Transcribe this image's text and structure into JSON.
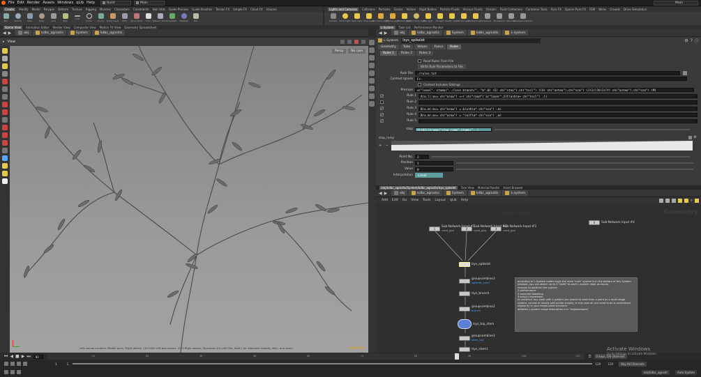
{
  "menubar": {
    "items": [
      "File",
      "Edit",
      "Render",
      "Assets",
      "Windows",
      "qLib",
      "Help"
    ],
    "build": "Build",
    "main": "Main",
    "right_main": "Main"
  },
  "shelf_tabs_left": [
    "Create",
    "Modify",
    "Model",
    "Polygon",
    "Deform",
    "Texture",
    "Rigging",
    "Muscles",
    "Characters",
    "Constraints",
    "Hair Utils",
    "Guide Process",
    "Guide Brushes",
    "Terrain FX",
    "Simple FX",
    "Cloud FX",
    "Volume"
  ],
  "shelf_tabs_right": [
    "Lights and Cameras",
    "Collisions",
    "Particles",
    "Grains",
    "Vellum",
    "Rigid Bodies",
    "Particle Fluids",
    "Viscous Fluids",
    "Oceans",
    "Fluid Containers",
    "Container Tools",
    "Pyro FX",
    "Sparse Pyro FX",
    "FEM",
    "Wires",
    "Crowds",
    "Drive Simulation"
  ],
  "shelf_tools_left": [
    "Box",
    "Sphere",
    "Tube",
    "Torus",
    "Grid",
    "Null",
    "Line",
    "Circle",
    "Curve",
    "Draw Curve",
    "Path",
    "Spray Paint",
    "Font",
    "Platonic Solids",
    "L-System",
    "Metaball",
    "File"
  ],
  "shelf_tools_right": [
    "Camera",
    "Point Light",
    "Spot Light",
    "Area Light",
    "Geometry Light",
    "Volume Light",
    "Distant Light",
    "Environment Light",
    "Sky Light",
    "GI Light",
    "Caustic Light",
    "Portal Light",
    "Ambient Light",
    "Camera",
    "VR Camera",
    "Switcher",
    "Gamepad Camera"
  ],
  "pane_tabs": [
    "Scene View",
    "Animation Editor",
    "Render View",
    "Composite View",
    "Motion FX View",
    "Geometry Spreadsheet"
  ],
  "path_left": {
    "obj": "obj",
    "node": "kdbc_agrostis",
    "system": "System",
    "geo": "kdbc_agrostis"
  },
  "viewport": {
    "title": "View",
    "persp": "Persp",
    "cam": "No cam",
    "status": "Left mouse tumbles. Middle pans. Right dollies. Ctrl+Alt+Left box-zooms. Ctrl+Right zooms. Spacebar-Ctrl-Left tilts. Hold L for alternate tumble, dolly, and zoom.",
    "indie": "Indie Edition"
  },
  "params": {
    "tabs": [
      "L-System",
      "Take List",
      "Performance Monitor"
    ],
    "path": {
      "obj": "obj",
      "node": "kdbc_agrostis",
      "system": "System",
      "geo": "kdbc_agrostis",
      "lsys": "L-system"
    },
    "node_type": "L-System",
    "node_name": "lsys_spikelet",
    "main_tabs": [
      "Geometry",
      "Tube",
      "Values",
      "Funcs",
      "Rules"
    ],
    "rule_tabs": [
      "Rules 1",
      "Rules 2",
      "Rules 3"
    ],
    "read_rules": "Read Rules From File",
    "write_rules": "Write Rule Parameters to File",
    "rule_file_label": "Rule File",
    "rule_file": "./rules.txt",
    "ctx_ignore_label": "Context Ignore",
    "ctx_ignore": "F+-",
    "ctx_siblings": "Context Includes Siblings",
    "premise_label": "Premise",
    "premise": "a(\"level\", stamp(\"../lsys_branch/\", \"m\",0) )E( ch(\"step\"),ch(\"tscl\") )[X( ch(\"astep\"),ch(\"sca\") )J(1)][K(1)[Y( ch(\"astep\"),ch(\"sca\") )M(",
    "rules": [
      {
        "label": "Rule 1",
        "value": "A(a,l):g<= ch(\"grow\") =~(`ch(\"rand\")`a(\"layer\",2)F(a)A(a+ ch(\"tscl\") ,l)"
      },
      {
        "label": "Rule 2",
        "value": ""
      },
      {
        "label": "Rule 3",
        "value": "B(a,m):g<= ch(\"grow\") = &(a)K(a* ch(\"sca\") ,m)"
      },
      {
        "label": "Rule 4",
        "value": "B(a,m):g<= ch(\"grow\") = ^(a)Y(a* ch(\"sca\") ,m)"
      },
      {
        "label": "Rule 5",
        "value": ""
      }
    ],
    "step_label": "step",
    "step_value": "fit01(chramp(\"step_ramp\",stamp(\"..)",
    "step_ramp": "step_ramp",
    "point_no_label": "Point No.",
    "point_no": "2",
    "position_label": "Position",
    "position": "1",
    "value_label": "Value",
    "value": "0",
    "interp_label": "Interpolation",
    "interp": "Linear"
  },
  "network": {
    "pane_tabs": [
      "/obj/kdbc_agrostis/System/kdbc_agrostis/lsys_spikelet",
      "Tree View",
      "Material Palette",
      "Asset Browser"
    ],
    "path": {
      "obj": "obj",
      "node": "kdbc_agrostis",
      "system": "System",
      "geo": "kdbc_agrostis",
      "lsys": "L-system"
    },
    "menu": [
      "Add",
      "Edit",
      "Go",
      "View",
      "Tools",
      "Layout",
      "qLib",
      "Help"
    ],
    "indie": "Indie Edition",
    "context": "Geometry",
    "inputs": [
      {
        "num": "1",
        "label": "Sub-Network Input #1",
        "sub": "used_geo"
      },
      {
        "num": "2",
        "label": "Sub-Network Input #2",
        "sub": "used_geo"
      },
      {
        "num": "3",
        "label": "Sub-Network Input #3",
        "sub": "used_geo"
      },
      {
        "num": "4",
        "label": "Sub-Network Input #4",
        "sub": ""
      }
    ],
    "nodes": [
      {
        "label": "lsys_spikelet",
        "sub": ""
      },
      {
        "label": "groupcombine3",
        "sub": "spikelet_seed"
      },
      {
        "label": "lsys_branch",
        "sub": ""
      },
      {
        "label": "groupcombine2",
        "sub": "branch"
      },
      {
        "label": "lsys_top_stem",
        "sub": ""
      },
      {
        "label": "groupcombine1",
        "sub": "stem_top"
      },
      {
        "label": "lsys_stem1",
        "sub": ""
      }
    ],
    "sticky": [
      "according to L-System node's logic the main \"core\" system is in the bottom of this System network, you can attach up to 3 \"leafs\" to each L-system node as inputs.",
      "reasons to partition the system:",
      "1 performance",
      "2 separate tweaking",
      "3 easy(!) expression",
      "to construct any plant with L-system you should to start from a plant as a multi-stage system, consist of mostly self-similar shapes, in this case all you need to do is understand regularity in your target plant structure.",
      "detailed L-system usage description is in \"obj/examples\""
    ]
  },
  "timeline": {
    "frame": "92",
    "start": "1",
    "start2": "1",
    "end": "120",
    "end2": "120",
    "ticks": [
      "12",
      "24",
      "36",
      "48",
      "60",
      "72",
      "84",
      "96",
      "108",
      "120"
    ],
    "channel_note": "0 keys, 0/0 channels",
    "key_all": "Key All Channels",
    "auto_update": "Auto Update",
    "status": "/obj/kdbc_agrost/",
    "watermark_title": "Activate Windows",
    "watermark_sub": "Go to Settings to activate Windows."
  }
}
